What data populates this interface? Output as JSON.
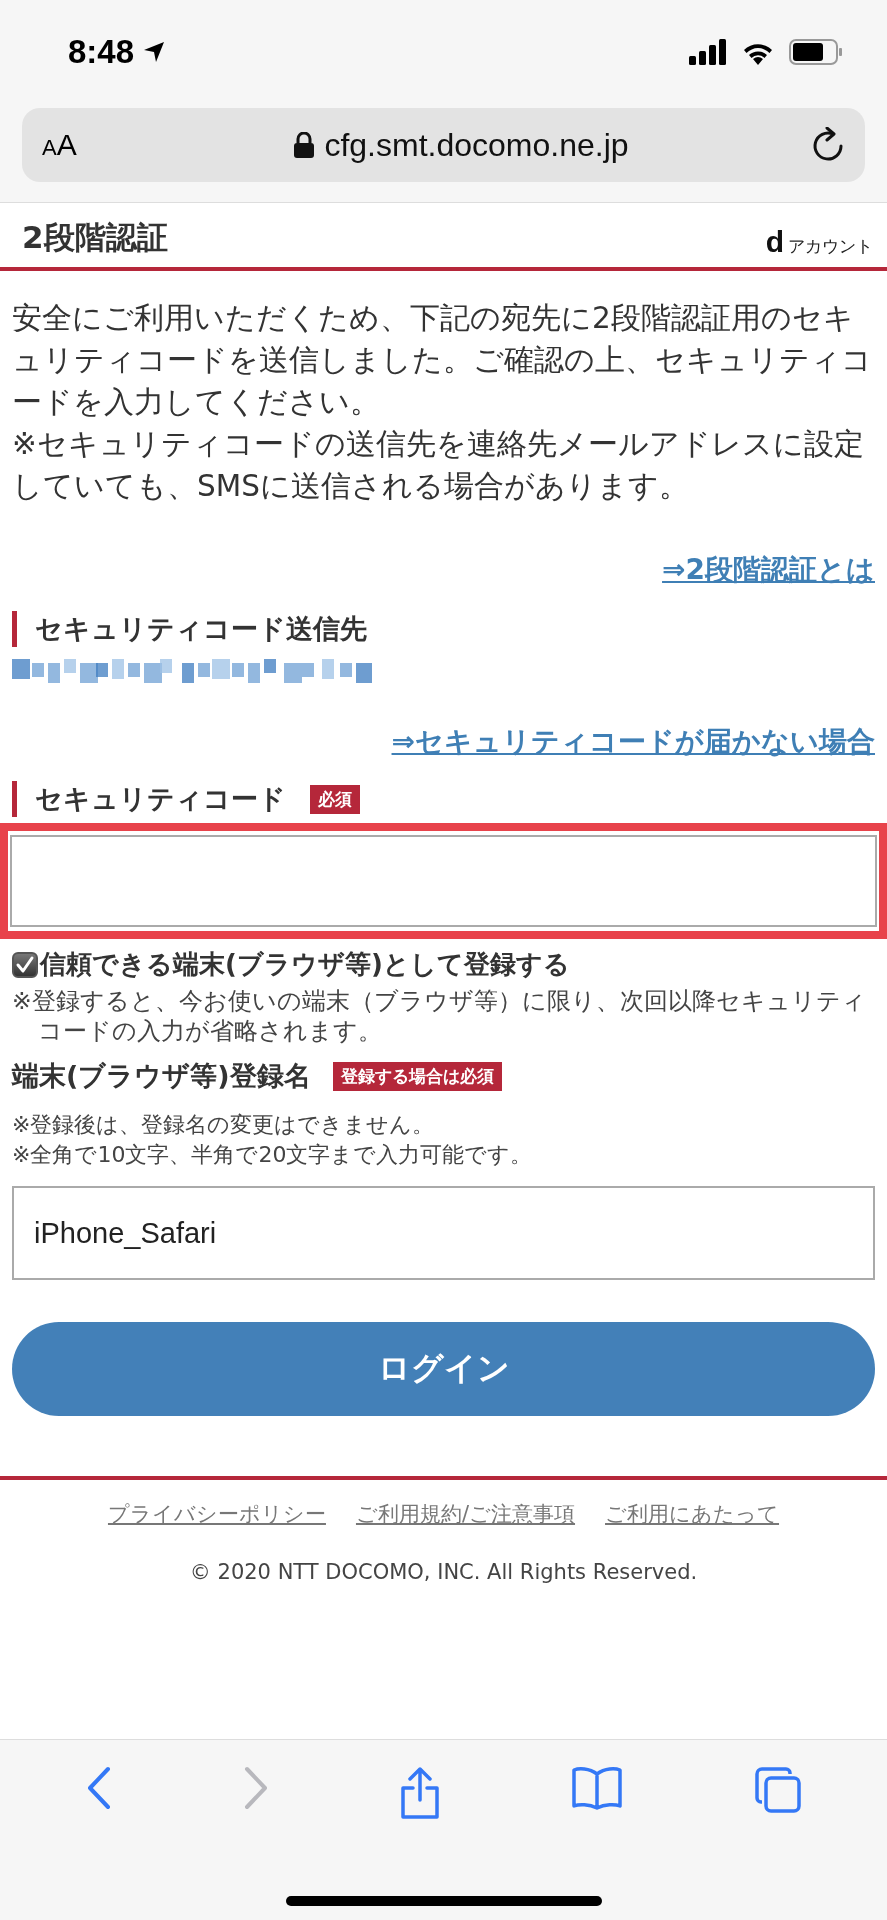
{
  "status_bar": {
    "time": "8:48"
  },
  "browser": {
    "text_size_button": "AA",
    "url": "cfg.smt.docomo.ne.jp"
  },
  "header": {
    "title": "2段階認証",
    "brand_mark": "d",
    "brand_text": "アカウント"
  },
  "intro": [
    "安全にご利用いただくため、下記の宛先に2段階認証用のセキュリティコードを送信しました。ご確認の上、セキュリティコードを入力してください。",
    "※セキュリティコードの送信先を連絡先メールアドレスに設定していても、SMSに送信される場合があります。"
  ],
  "about_link": "⇒2段階認証とは",
  "destination": {
    "heading": "セキュリティコード送信先",
    "not_received_link": "⇒セキュリティコードが届かない場合"
  },
  "code_field": {
    "label": "セキュリティコード",
    "badge": "必須",
    "highlighted": true
  },
  "trust_device": {
    "label": "信頼できる端末(ブラウザ等)として登録する",
    "checked": true,
    "note": "※登録すると、今お使いの端末（ブラウザ等）に限り、次回以降セキュリティコードの入力が省略されます。"
  },
  "device_name": {
    "label": "端末(ブラウザ等)登録名",
    "badge": "登録する場合は必須",
    "notes": [
      "※登録後は、登録名の変更はできません。",
      "※全角で10文字、半角で20文字まで入力可能です。"
    ],
    "value": "iPhone_Safari"
  },
  "login_button": "ログイン",
  "footer": {
    "links": [
      "プライバシーポリシー",
      "ご利用規約/ご注意事項",
      "ご利用にあたって"
    ],
    "copyright": "© 2020 NTT DOCOMO, INC. All Rights Reserved."
  },
  "toolbar": [
    {
      "kind": "back",
      "disabled": false
    },
    {
      "kind": "forward",
      "disabled": true
    },
    {
      "kind": "share",
      "disabled": false
    },
    {
      "kind": "bookmarks",
      "disabled": false
    },
    {
      "kind": "tabs",
      "disabled": false
    }
  ]
}
